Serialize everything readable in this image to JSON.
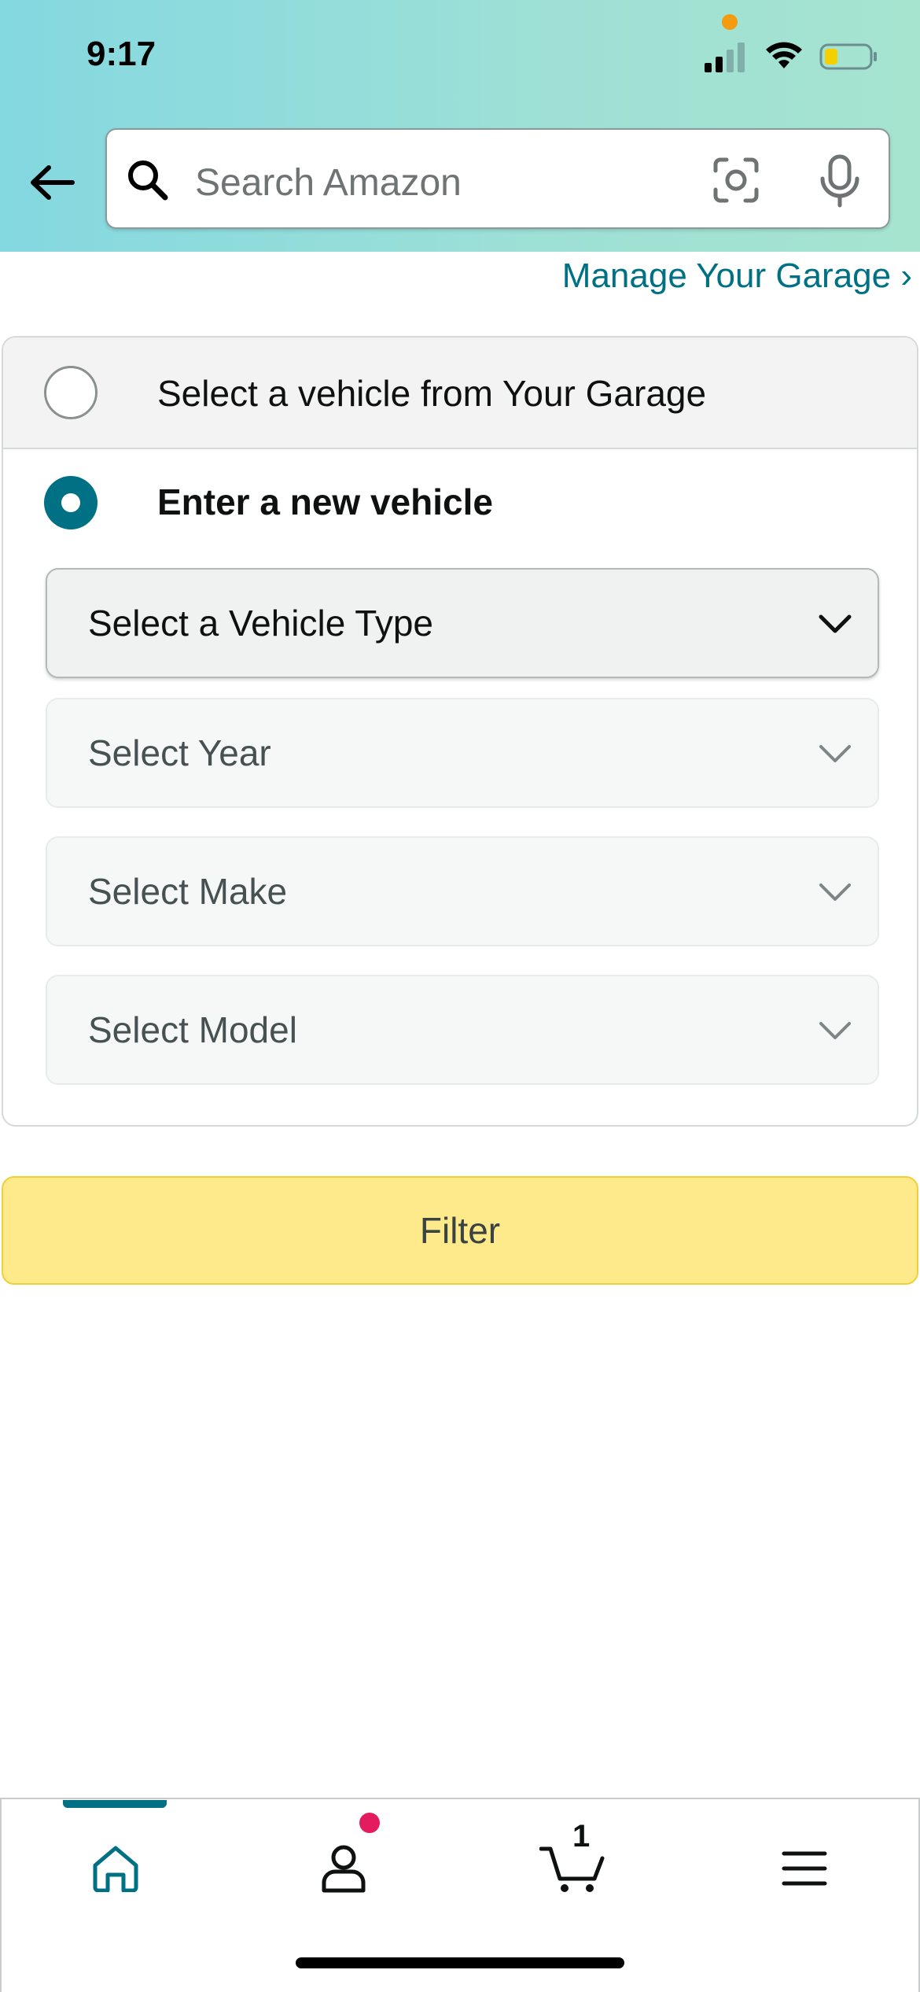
{
  "status_bar": {
    "time": "9:17"
  },
  "search": {
    "placeholder": "Search Amazon"
  },
  "garage": {
    "manage_link": "Manage Your Garage ›",
    "option_garage_label": "Select a vehicle from Your Garage",
    "option_new_label": "Enter a new vehicle",
    "selected_option": "new"
  },
  "dropdowns": {
    "vehicle_type": "Select a Vehicle Type",
    "year": "Select Year",
    "make": "Select Make",
    "model": "Select Model"
  },
  "filter_button": "Filter",
  "bottom_nav": {
    "active": "home",
    "cart_count": "1",
    "items": [
      "home-icon",
      "account-icon",
      "cart-icon",
      "menu-icon"
    ]
  },
  "colors": {
    "accent": "#007185",
    "filter_button": "#feea8a",
    "notification_dot": "#e31c5f"
  }
}
